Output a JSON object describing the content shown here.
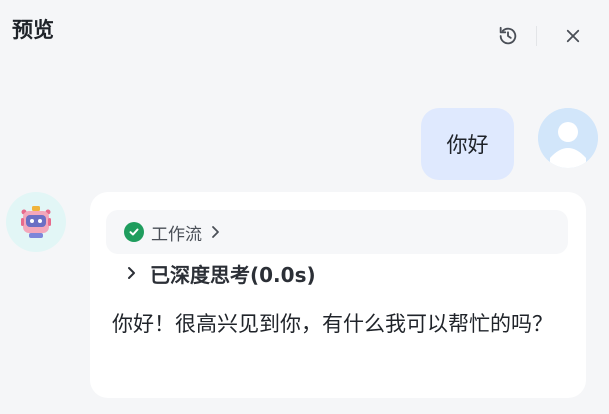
{
  "header": {
    "title": "预览"
  },
  "messages": {
    "user": {
      "text": "你好"
    },
    "bot": {
      "workflow_label": "工作流",
      "thinking_label": "已深度思考(0.0s)",
      "reply": "你好！很高兴见到你，有什么我可以帮忙的吗？"
    }
  },
  "icons": {
    "refresh": "refresh-icon",
    "close": "close-icon",
    "check": "check-circle-icon",
    "chevron": "chevron-right-icon",
    "user_avatar": "user-avatar-icon",
    "bot_avatar": "robot-avatar-icon"
  },
  "colors": {
    "background": "#f5f6f8",
    "user_bubble": "#dfe9fe",
    "bot_bubble": "#ffffff",
    "success": "#1f9d5e"
  }
}
